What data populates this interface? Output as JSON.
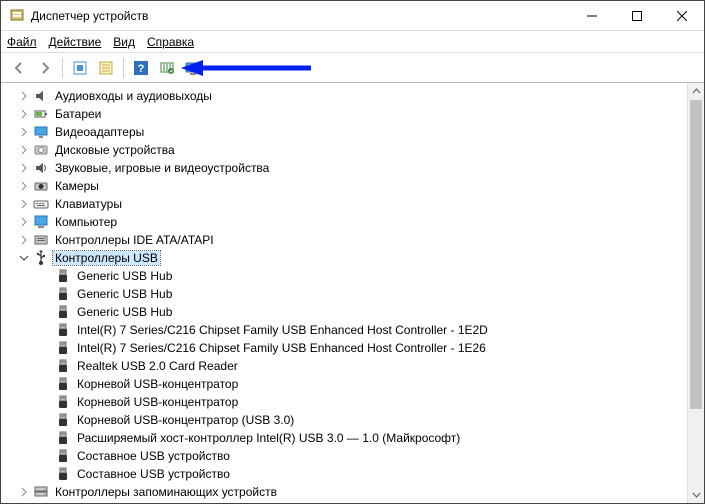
{
  "window": {
    "title": "Диспетчер устройств"
  },
  "menubar": {
    "file": "Файл",
    "action": "Действие",
    "view": "Вид",
    "help": "Справка"
  },
  "toolbar": {
    "back": "back",
    "forward": "forward",
    "show_hidden": "show-hidden",
    "properties": "properties",
    "help": "help",
    "scan": "scan-hardware",
    "monitor": "scan-for-changes"
  },
  "tree": {
    "categories": [
      {
        "label": "Аудиовходы и аудиовыходы",
        "expanded": false,
        "icon": "audio",
        "children": []
      },
      {
        "label": "Батареи",
        "expanded": false,
        "icon": "battery",
        "children": []
      },
      {
        "label": "Видеоадаптеры",
        "expanded": false,
        "icon": "display",
        "children": []
      },
      {
        "label": "Дисковые устройства",
        "expanded": false,
        "icon": "disk",
        "children": []
      },
      {
        "label": "Звуковые, игровые и видеоустройства",
        "expanded": false,
        "icon": "sound",
        "children": []
      },
      {
        "label": "Камеры",
        "expanded": false,
        "icon": "camera",
        "children": []
      },
      {
        "label": "Клавиатуры",
        "expanded": false,
        "icon": "keyboard",
        "children": []
      },
      {
        "label": "Компьютер",
        "expanded": false,
        "icon": "computer",
        "children": []
      },
      {
        "label": "Контроллеры IDE ATA/ATAPI",
        "expanded": false,
        "icon": "ide",
        "children": []
      },
      {
        "label": "Контроллеры USB",
        "expanded": true,
        "icon": "usb",
        "selected": true,
        "children": [
          {
            "label": "Generic USB Hub",
            "icon": "usb-plug"
          },
          {
            "label": "Generic USB Hub",
            "icon": "usb-plug"
          },
          {
            "label": "Generic USB Hub",
            "icon": "usb-plug"
          },
          {
            "label": "Intel(R) 7 Series/C216 Chipset Family USB Enhanced Host Controller - 1E2D",
            "icon": "usb-plug"
          },
          {
            "label": "Intel(R) 7 Series/C216 Chipset Family USB Enhanced Host Controller - 1E26",
            "icon": "usb-plug"
          },
          {
            "label": "Realtek USB 2.0 Card Reader",
            "icon": "usb-plug"
          },
          {
            "label": "Корневой USB-концентратор",
            "icon": "usb-plug"
          },
          {
            "label": "Корневой USB-концентратор",
            "icon": "usb-plug"
          },
          {
            "label": "Корневой USB-концентратор (USB 3.0)",
            "icon": "usb-plug"
          },
          {
            "label": "Расширяемый хост-контроллер Intel(R) USB 3.0 — 1.0 (Майкрософт)",
            "icon": "usb-plug"
          },
          {
            "label": "Составное USB устройство",
            "icon": "usb-plug"
          },
          {
            "label": "Составное USB устройство",
            "icon": "usb-plug"
          }
        ]
      },
      {
        "label": "Контроллеры запоминающих устройств",
        "expanded": false,
        "icon": "storage",
        "children": []
      }
    ]
  }
}
